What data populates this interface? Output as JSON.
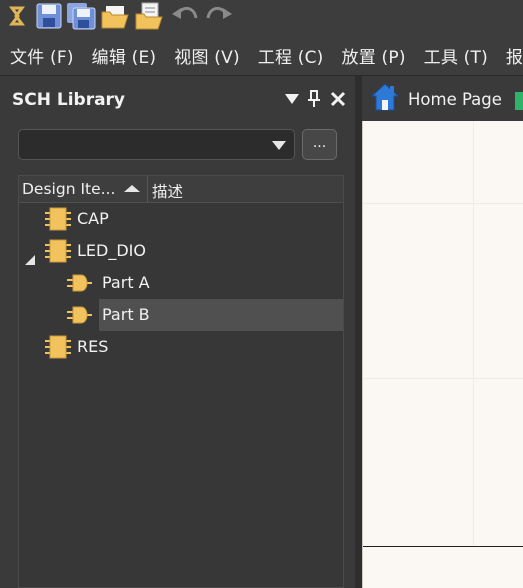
{
  "colors": {
    "chrome": "#3d3d3d",
    "panel": "#3a3a3a",
    "list_bg": "#373737",
    "selected_row": "#505050",
    "component_icon": "#f2c25c",
    "sheet": "#fbf8f3",
    "home_icon_blue": "#2e78d6"
  },
  "toolbar": {
    "icons": [
      "app-logo-icon",
      "save-icon",
      "save-all-icon",
      "open-folder-icon",
      "open-document-icon",
      "undo-icon",
      "redo-icon"
    ]
  },
  "menu": {
    "items": [
      "文件 (F)",
      "编辑 (E)",
      "视图 (V)",
      "工程 (C)",
      "放置 (P)",
      "工具 (T)",
      "报告"
    ]
  },
  "panel": {
    "title": "SCH Library",
    "dropdown_value": "",
    "ellipsis_label": "...",
    "columns": {
      "name": "Design Ite...",
      "description": "描述"
    },
    "items": [
      {
        "label": "CAP",
        "type": "component"
      },
      {
        "label": "LED_DIO",
        "type": "component",
        "expanded": true
      },
      {
        "label": "Part A",
        "type": "part"
      },
      {
        "label": "Part B",
        "type": "part",
        "selected": true
      },
      {
        "label": "RES",
        "type": "component"
      }
    ]
  },
  "document": {
    "tab_label": "Home Page"
  }
}
